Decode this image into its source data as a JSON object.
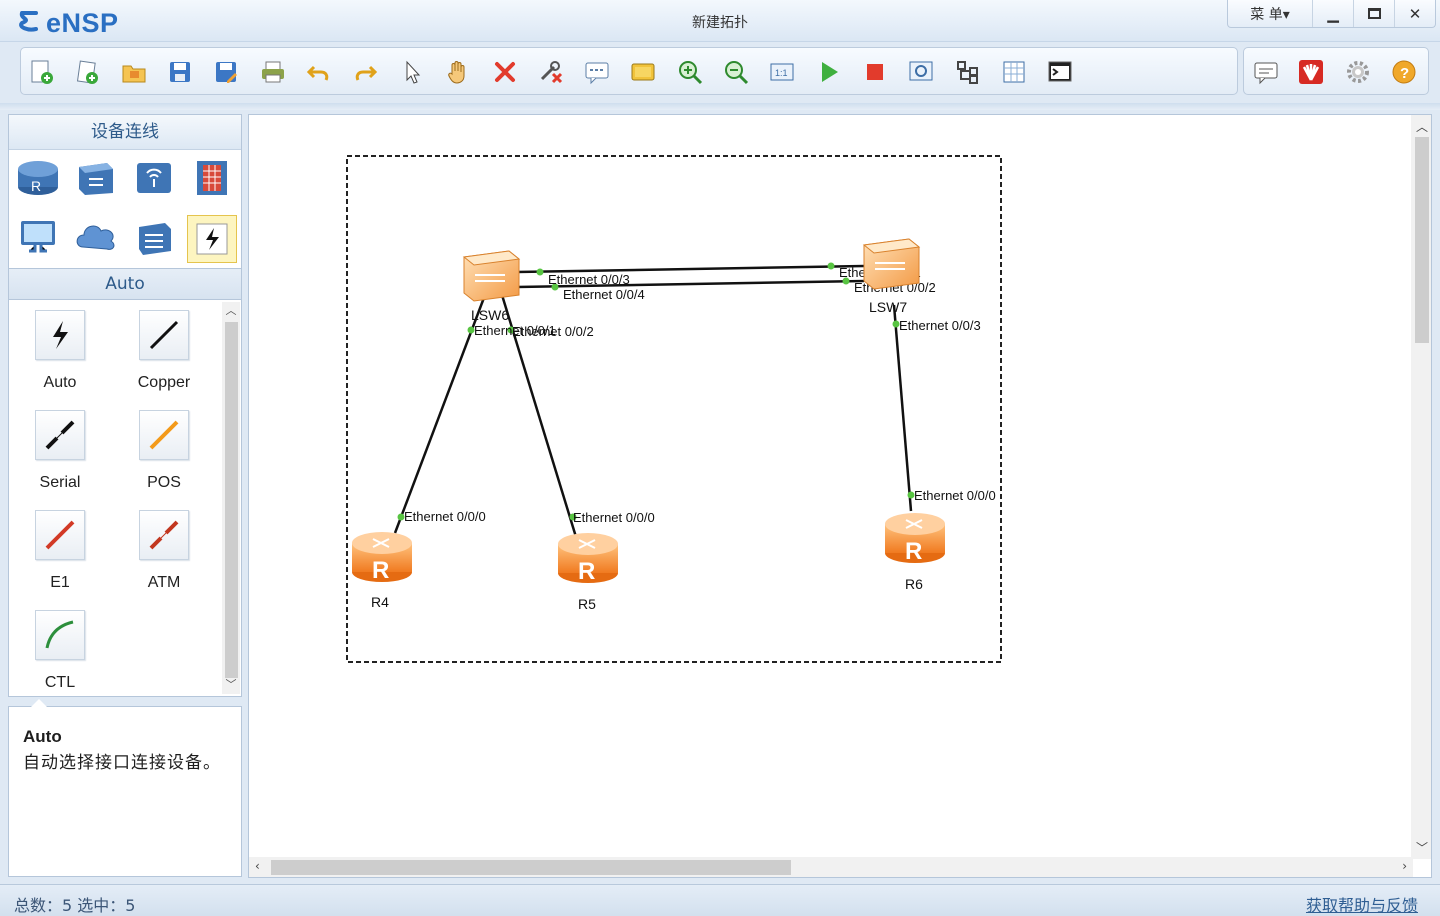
{
  "app": {
    "name": "eNSP",
    "window_title": "新建拓扑"
  },
  "window_controls": {
    "menu_label": "菜 单▾",
    "minimize": "—",
    "maximize": "□",
    "close": "✕"
  },
  "toolbar": {
    "items": [
      "new-topology",
      "new-example",
      "open",
      "save",
      "save-as",
      "print",
      "undo",
      "redo",
      "select",
      "pan",
      "delete",
      "delete-all-links",
      "text-note",
      "palette",
      "zoom-in",
      "zoom-out",
      "fit",
      "start-device",
      "stop-device",
      "capture",
      "topology-tree",
      "grid",
      "console"
    ],
    "right_items": [
      "message",
      "huawei",
      "settings",
      "help"
    ]
  },
  "device_panel": {
    "title": "设备连线",
    "categories": [
      "router",
      "switch",
      "wireless",
      "firewall",
      "pc",
      "cloud",
      "other-device",
      "cable"
    ],
    "selected_category_label": "Auto"
  },
  "cables": [
    {
      "label": "Auto",
      "color": "#111111"
    },
    {
      "label": "Copper",
      "color": "#111111"
    },
    {
      "label": "Serial",
      "color": "#111111"
    },
    {
      "label": "POS",
      "color": "#f39a1a"
    },
    {
      "label": "E1",
      "color": "#d23a26"
    },
    {
      "label": "ATM",
      "color": "#c2371f"
    },
    {
      "label": "CTL",
      "color": "#2c8f3c"
    }
  ],
  "description": {
    "title": "Auto",
    "text": "自动选择接口连接设备。"
  },
  "topology": {
    "devices": [
      {
        "name": "LSW6",
        "type": "switch"
      },
      {
        "name": "LSW7",
        "type": "switch"
      },
      {
        "name": "R4",
        "type": "router"
      },
      {
        "name": "R5",
        "type": "router"
      },
      {
        "name": "R6",
        "type": "router"
      }
    ],
    "links": [
      {
        "a": "LSW6",
        "a_port": "Ethernet 0/0/3",
        "b": "LSW7",
        "b_port": "Ethernet 0/0/1"
      },
      {
        "a": "LSW6",
        "a_port": "Ethernet 0/0/4",
        "b": "LSW7",
        "b_port": "Ethernet 0/0/2"
      },
      {
        "a": "LSW6",
        "a_port": "Ethernet 0/0/1",
        "b": "R4",
        "b_port": "Ethernet 0/0/0"
      },
      {
        "a": "LSW6",
        "a_port": "Ethernet 0/0/2",
        "b": "R5",
        "b_port": "Ethernet 0/0/0"
      },
      {
        "a": "LSW7",
        "a_port": "Ethernet 0/0/3",
        "b": "R6",
        "b_port": "Ethernet 0/0/0"
      }
    ]
  },
  "status": {
    "left": "总数：5  选中：5",
    "help_link": "获取帮助与反馈"
  }
}
